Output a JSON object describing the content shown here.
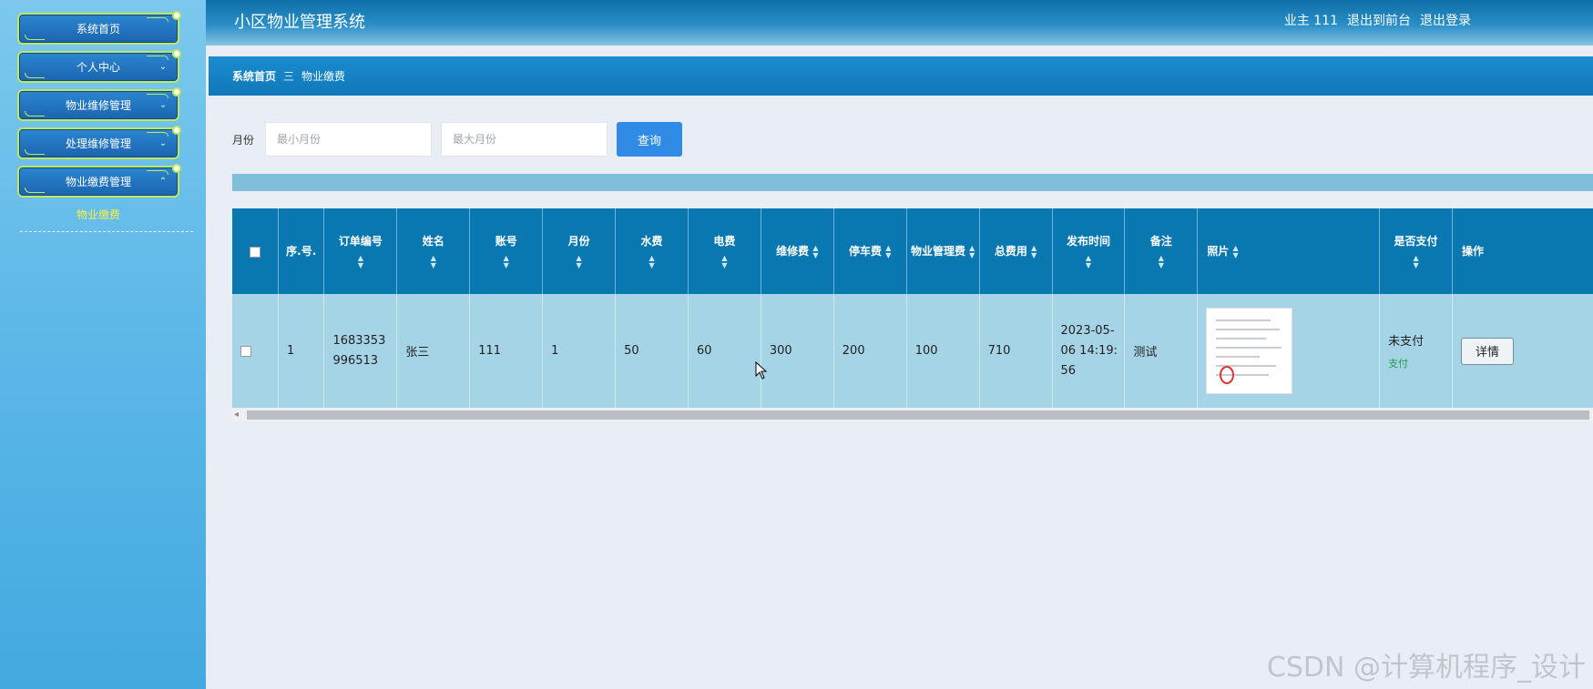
{
  "app": {
    "title": "小区物业管理系统",
    "user_label": "业主 111",
    "back_to_front": "退出到前台",
    "logout": "退出登录"
  },
  "sidebar": {
    "items": [
      {
        "label": "系统首页"
      },
      {
        "label": "个人中心"
      },
      {
        "label": "物业维修管理"
      },
      {
        "label": "处理维修管理"
      },
      {
        "label": "物业缴费管理"
      }
    ],
    "sub_item": "物业缴费",
    "accent_color": "#bfe95c"
  },
  "breadcrumb": {
    "home": "系统首页",
    "separator": "三",
    "current": "物业缴费"
  },
  "search": {
    "label": "月份",
    "min_placeholder": "最小月份",
    "max_placeholder": "最大月份",
    "button": "查询"
  },
  "table": {
    "headers": {
      "index": "序.号.",
      "order_no": "订单编号",
      "name": "姓名",
      "account": "账号",
      "month": "月份",
      "water": "水费",
      "electric": "电费",
      "repair": "维修费",
      "parking": "停车费",
      "property": "物业管理费",
      "total": "总费用",
      "publish_time": "发布时间",
      "remark": "备注",
      "photo": "照片",
      "paid": "是否支付",
      "action": "操作"
    },
    "rows": [
      {
        "index": "1",
        "order_no": "1683353996513",
        "name": "张三",
        "account": "111",
        "month": "1",
        "water": "50",
        "electric": "60",
        "repair": "300",
        "parking": "200",
        "property": "100",
        "total": "710",
        "publish_time": "2023-05-06 14:19:56",
        "remark": "测试",
        "paid_status": "未支付",
        "pay_link": "支付",
        "detail_button": "详情"
      }
    ]
  },
  "watermark": "CSDN @计算机程序_设计",
  "colors": {
    "header": "#0f6fa8",
    "table_header": "#0a78b0",
    "row": "#a6d4e7",
    "search_button": "#2f8be6"
  }
}
